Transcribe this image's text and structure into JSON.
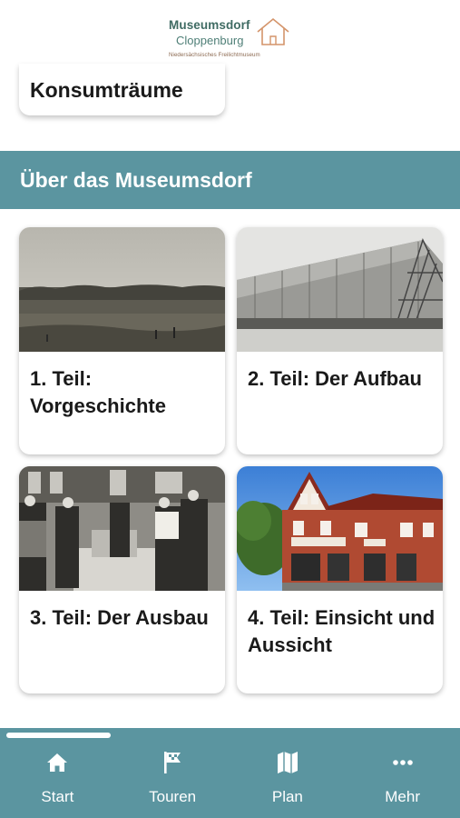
{
  "header": {
    "logo_line1": "Museumsdorf",
    "logo_line2": "Cloppenburg",
    "logo_line3": "Niedersächsisches Freilichtmuseum"
  },
  "top_card": {
    "title": "Konsumträume"
  },
  "section": {
    "title": "Über das Museumsdorf"
  },
  "cards": [
    {
      "title": "1. Teil: Vorgeschichte",
      "image": "historic-landscape-photo"
    },
    {
      "title": "2. Teil: Der Aufbau",
      "image": "barn-construction-photo"
    },
    {
      "title": "3. Teil: Der Ausbau",
      "image": "workers-building-photo"
    },
    {
      "title": "4. Teil: Einsicht und Aussicht",
      "image": "brick-inn-photo"
    }
  ],
  "tabbar": {
    "items": [
      {
        "label": "Start",
        "icon": "home-icon"
      },
      {
        "label": "Touren",
        "icon": "flag-icon"
      },
      {
        "label": "Plan",
        "icon": "map-icon"
      },
      {
        "label": "Mehr",
        "icon": "more-icon"
      }
    ]
  },
  "colors": {
    "accent": "#5b95a0",
    "logo_green": "#3f6b63",
    "logo_orange": "#d4946a"
  }
}
